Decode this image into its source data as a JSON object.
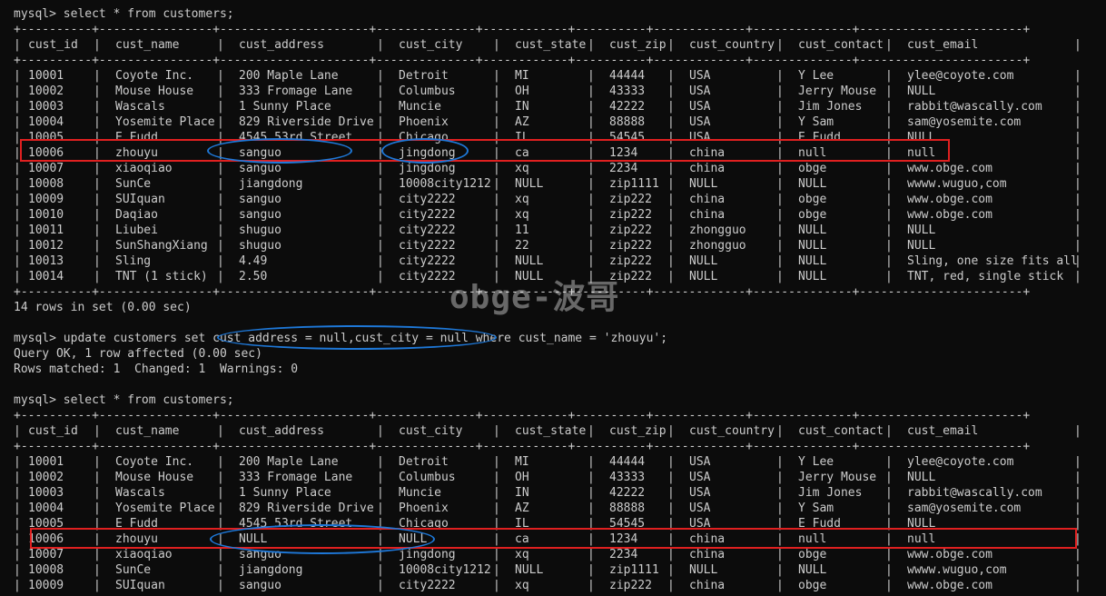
{
  "first_query": {
    "prompt": "mysql> select * from customers;",
    "border": "+----------+----------------+---------------------+--------------+------------+----------+-------------+--------------+-----------------------+",
    "headers": [
      "cust_id",
      "cust_name",
      "cust_address",
      "cust_city",
      "cust_state",
      "cust_zip",
      "cust_country",
      "cust_contact",
      "cust_email"
    ],
    "rows": [
      [
        "10001",
        "Coyote Inc.",
        "200 Maple Lane",
        "Detroit",
        "MI",
        "44444",
        "USA",
        "Y Lee",
        "ylee@coyote.com"
      ],
      [
        "10002",
        "Mouse House",
        "333 Fromage Lane",
        "Columbus",
        "OH",
        "43333",
        "USA",
        "Jerry Mouse",
        "NULL"
      ],
      [
        "10003",
        "Wascals",
        "1 Sunny Place",
        "Muncie",
        "IN",
        "42222",
        "USA",
        "Jim Jones",
        "rabbit@wascally.com"
      ],
      [
        "10004",
        "Yosemite Place",
        "829 Riverside Drive",
        "Phoenix",
        "AZ",
        "88888",
        "USA",
        "Y Sam",
        "sam@yosemite.com"
      ],
      [
        "10005",
        "E Fudd",
        "4545 53rd Street",
        "Chicago",
        "IL",
        "54545",
        "USA",
        "E Fudd",
        "NULL"
      ],
      [
        "10006",
        "zhouyu",
        "sanguo",
        "jingdong",
        "ca",
        "1234",
        "china",
        "null",
        "null"
      ],
      [
        "10007",
        "xiaoqiao",
        "sanguo",
        "jingdong",
        "xq",
        "2234",
        "china",
        "obge",
        "www.obge.com"
      ],
      [
        "10008",
        "SunCe",
        "jiangdong",
        "10008city1212",
        "NULL",
        "zip1111",
        "NULL",
        "NULL",
        "wwww.wuguo,com"
      ],
      [
        "10009",
        "SUIquan",
        "sanguo",
        "city2222",
        "xq",
        "zip222",
        "china",
        "obge",
        "www.obge.com"
      ],
      [
        "10010",
        "Daqiao",
        "sanguo",
        "city2222",
        "xq",
        "zip222",
        "china",
        "obge",
        "www.obge.com"
      ],
      [
        "10011",
        "Liubei",
        "shuguo",
        "city2222",
        "11",
        "zip222",
        "zhongguo",
        "NULL",
        "NULL"
      ],
      [
        "10012",
        "SunShangXiang",
        "shuguo",
        "city2222",
        "22",
        "zip222",
        "zhongguo",
        "NULL",
        "NULL"
      ],
      [
        "10013",
        "Sling",
        "4.49",
        "city2222",
        "NULL",
        "zip222",
        "NULL",
        "NULL",
        "Sling, one size fits all"
      ],
      [
        "10014",
        "TNT (1 stick)",
        "2.50",
        "city2222",
        "NULL",
        "zip222",
        "NULL",
        "NULL",
        "TNT, red, single stick"
      ]
    ],
    "summary": "14 rows in set (0.00 sec)"
  },
  "update_command": {
    "prompt": "mysql> update customers set cust_address = null,cust_city = null where cust_name = 'zhouyu';",
    "result_1": "Query OK, 1 row affected (0.00 sec)",
    "result_2": "Rows matched: 1  Changed: 1  Warnings: 0"
  },
  "second_query": {
    "prompt": "mysql> select * from customers;",
    "rows": [
      [
        "10001",
        "Coyote Inc.",
        "200 Maple Lane",
        "Detroit",
        "MI",
        "44444",
        "USA",
        "Y Lee",
        "ylee@coyote.com"
      ],
      [
        "10002",
        "Mouse House",
        "333 Fromage Lane",
        "Columbus",
        "OH",
        "43333",
        "USA",
        "Jerry Mouse",
        "NULL"
      ],
      [
        "10003",
        "Wascals",
        "1 Sunny Place",
        "Muncie",
        "IN",
        "42222",
        "USA",
        "Jim Jones",
        "rabbit@wascally.com"
      ],
      [
        "10004",
        "Yosemite Place",
        "829 Riverside Drive",
        "Phoenix",
        "AZ",
        "88888",
        "USA",
        "Y Sam",
        "sam@yosemite.com"
      ],
      [
        "10005",
        "E Fudd",
        "4545 53rd Street",
        "Chicago",
        "IL",
        "54545",
        "USA",
        "E Fudd",
        "NULL"
      ],
      [
        "10006",
        "zhouyu",
        "NULL",
        "NULL",
        "ca",
        "1234",
        "china",
        "null",
        "null"
      ],
      [
        "10007",
        "xiaoqiao",
        "sanguo",
        "jingdong",
        "xq",
        "2234",
        "china",
        "obge",
        "www.obge.com"
      ],
      [
        "10008",
        "SunCe",
        "jiangdong",
        "10008city1212",
        "NULL",
        "zip1111",
        "NULL",
        "NULL",
        "wwww.wuguo,com"
      ],
      [
        "10009",
        "SUIquan",
        "sanguo",
        "city2222",
        "xq",
        "zip222",
        "china",
        "obge",
        "www.obge.com"
      ]
    ]
  },
  "watermark": "obge-波哥",
  "colors": {
    "background": "#0c0c0c",
    "text": "#cccccc",
    "highlight_rect": "#e02020",
    "highlight_oval": "#1e78d8"
  }
}
